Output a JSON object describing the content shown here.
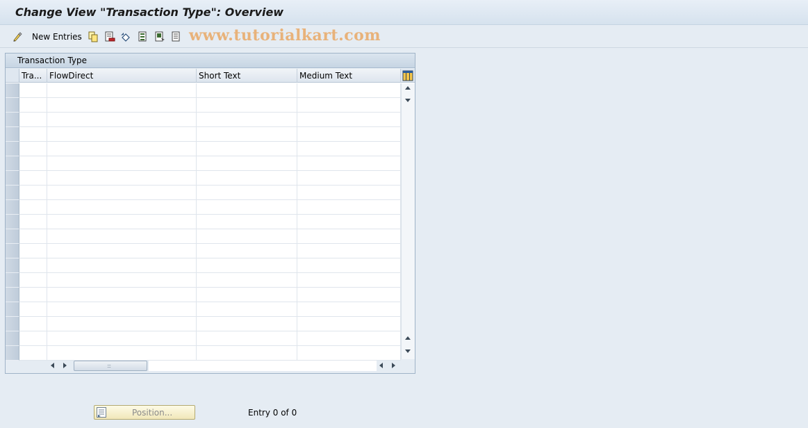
{
  "window": {
    "title": "Change View \"Transaction Type\": Overview"
  },
  "toolbar": {
    "new_entries_label": "New Entries",
    "icons": [
      "display-change-icon",
      "copy-icon",
      "delete-icon",
      "undo-icon",
      "select-all-icon",
      "select-block-icon",
      "deselect-all-icon"
    ],
    "watermark": "www.tutorialkart.com"
  },
  "panel": {
    "title": "Transaction Type",
    "columns": [
      {
        "label": "Tra..."
      },
      {
        "label": "FlowDirect"
      },
      {
        "label": "Short Text"
      },
      {
        "label": "Medium Text"
      }
    ],
    "visible_row_count": 19
  },
  "footer": {
    "position_label": "Position...",
    "entry_status": "Entry 0 of 0"
  }
}
